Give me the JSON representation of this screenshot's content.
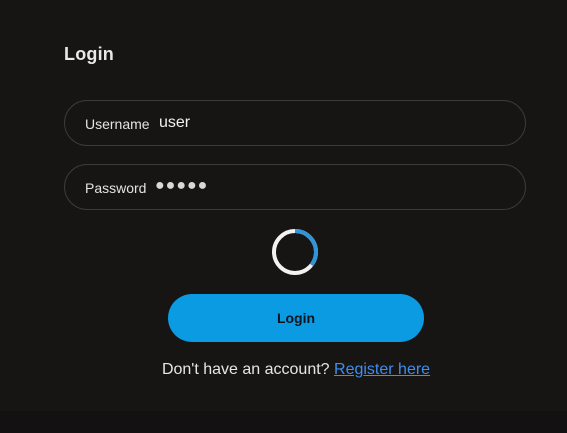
{
  "form": {
    "title": "Login",
    "username": {
      "label": "Username",
      "value": "user"
    },
    "password": {
      "label": "Password",
      "value": "●●●●●"
    },
    "submit_label": "Login",
    "loading": true
  },
  "footer": {
    "prompt": "Don't have an account?",
    "link_label": "Register here"
  },
  "colors": {
    "background": "#171414",
    "accent": "#0a9be3",
    "link": "#3d8ff0",
    "spinner_track": "#f2f2f2",
    "spinner_arc": "#2f95d8"
  },
  "icons": {
    "spinner": "loading-spinner-icon"
  }
}
